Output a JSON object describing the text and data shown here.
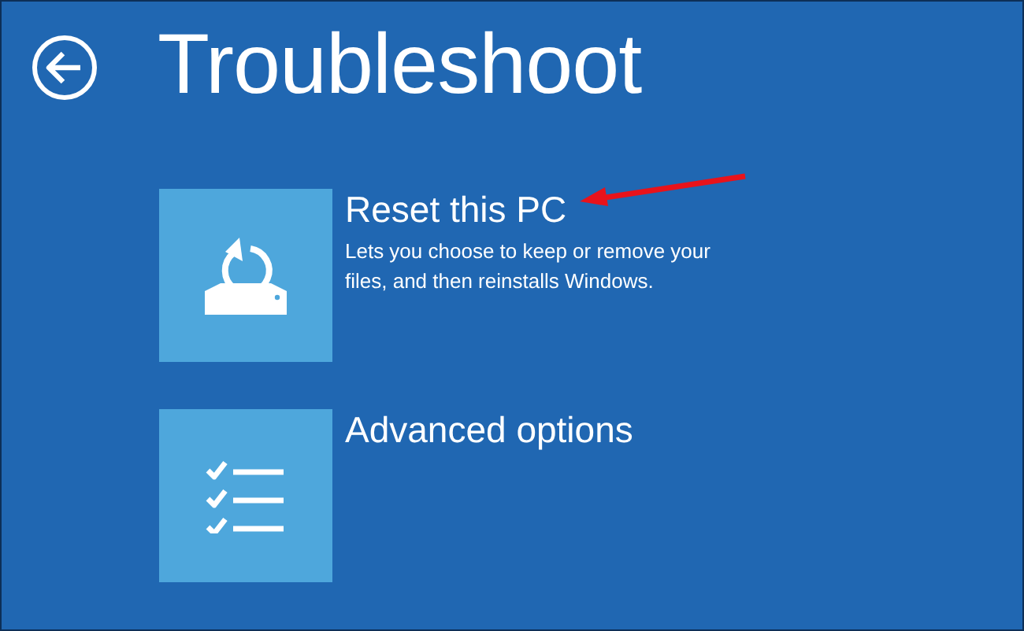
{
  "title": "Troubleshoot",
  "options": [
    {
      "kind": "reset",
      "title": "Reset this PC",
      "description": "Lets you choose to keep or remove your files, and then reinstalls Windows."
    },
    {
      "kind": "advanced",
      "title": "Advanced options"
    }
  ]
}
